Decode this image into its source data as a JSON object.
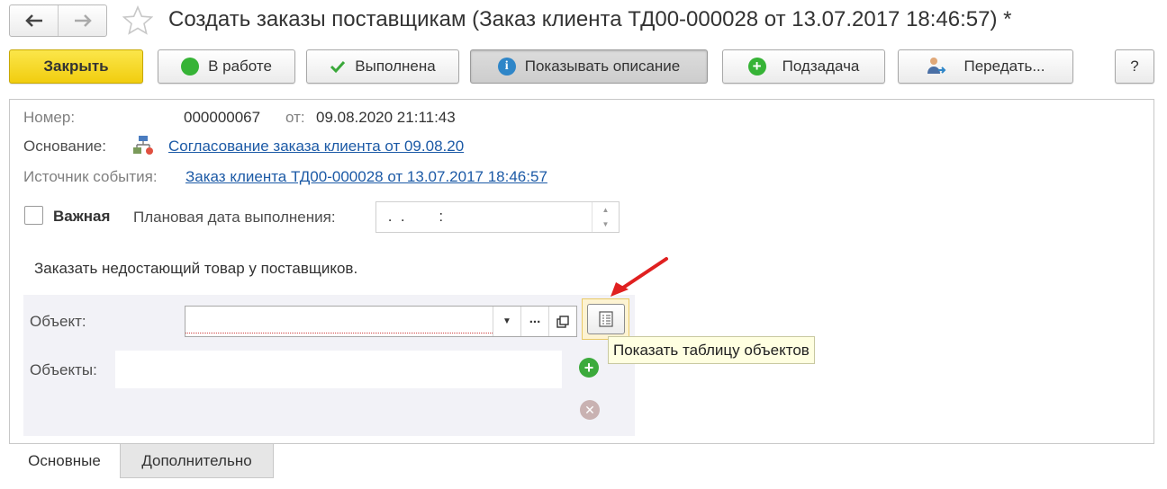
{
  "window": {
    "title": "Создать заказы поставщикам (Заказ клиента ТД00-000028 от 13.07.2017 18:46:57) *"
  },
  "toolbar": {
    "close_label": "Закрыть",
    "in_work_label": "В работе",
    "done_label": "Выполнена",
    "show_description_label": "Показывать описание",
    "subtask_label": "Подзадача",
    "transfer_label": "Передать...",
    "help_label": "?"
  },
  "form": {
    "number_label": "Номер:",
    "number_value": "000000067",
    "date_label": "от:",
    "date_value": "09.08.2020 21:11:43",
    "basis_label": "Основание:",
    "basis_link": "Согласование заказа клиента от 09.08.20",
    "source_label": "Источник события:",
    "source_link": "Заказ клиента ТД00-000028 от 13.07.2017 18:46:57",
    "important_label": "Важная",
    "planned_date_label": "Плановая дата выполнения:",
    "planned_date_mask": " .  .        :",
    "description": "Заказать недостающий товар у поставщиков.",
    "object_label": "Объект:",
    "objects_label": "Объекты:",
    "select_button_label": "...",
    "tooltip": "Показать таблицу объектов"
  },
  "tabs": [
    {
      "label": "Основные",
      "active": true
    },
    {
      "label": "Дополнительно",
      "active": false
    }
  ],
  "colors": {
    "accent_yellow": "#f5d31c",
    "link": "#1c5aa6",
    "tooltip_bg": "#ffffe1",
    "arrow_red": "#e02020"
  }
}
